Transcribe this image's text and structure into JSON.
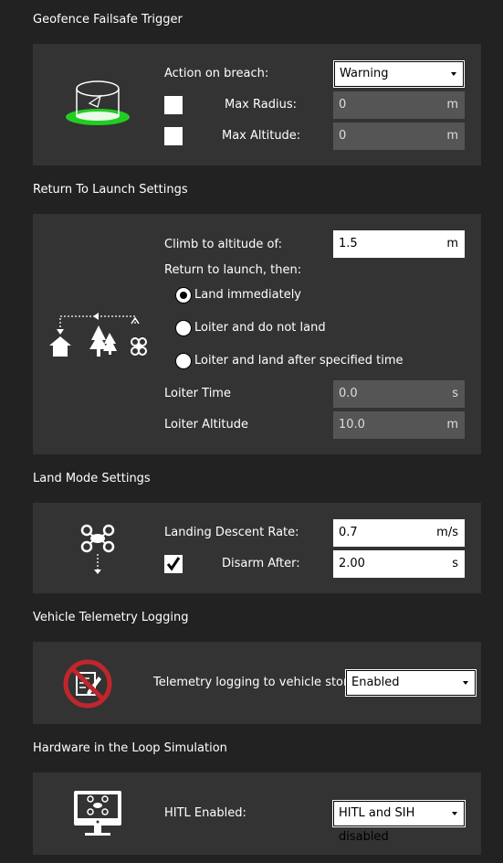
{
  "geofence": {
    "title": "Geofence Failsafe Trigger",
    "action_label": "Action on breach:",
    "action_value": "Warning",
    "max_radius_label": "Max Radius:",
    "max_radius_value": "0",
    "max_radius_unit": "m",
    "max_radius_checked": false,
    "max_altitude_label": "Max Altitude:",
    "max_altitude_value": "0",
    "max_altitude_unit": "m",
    "max_altitude_checked": false
  },
  "rtl": {
    "title": "Return To Launch Settings",
    "climb_label": "Climb to altitude of:",
    "climb_value": "1.5",
    "climb_unit": "m",
    "then_label": "Return to launch, then:",
    "options": [
      {
        "label": "Land immediately",
        "selected": true
      },
      {
        "label": "Loiter and do not land",
        "selected": false
      },
      {
        "label": "Loiter and land after specified time",
        "selected": false
      }
    ],
    "loiter_time_label": "Loiter Time",
    "loiter_time_value": "0.0",
    "loiter_time_unit": "s",
    "loiter_alt_label": "Loiter Altitude",
    "loiter_alt_value": "10.0",
    "loiter_alt_unit": "m"
  },
  "land": {
    "title": "Land Mode Settings",
    "descent_label": "Landing Descent Rate:",
    "descent_value": "0.7",
    "descent_unit": "m/s",
    "disarm_label": "Disarm After:",
    "disarm_checked": true,
    "disarm_value": "2.00",
    "disarm_unit": "s"
  },
  "telemetry": {
    "title": "Vehicle Telemetry Logging",
    "label": "Telemetry logging to vehicle storage:",
    "value": "Enabled"
  },
  "hitl": {
    "title": "Hardware in the Loop Simulation",
    "label": "HITL Enabled:",
    "value": "HITL and SIH disabled"
  },
  "icons": [
    "geofence-icon",
    "return-to-launch-icon",
    "land-icon",
    "no-logging-icon",
    "hitl-monitor-icon"
  ],
  "colors": {
    "background": "#222222",
    "panel": "#333333",
    "disabled_field": "#555555",
    "geofence_green": "#22cc22",
    "no_log_red": "#c0262c"
  }
}
